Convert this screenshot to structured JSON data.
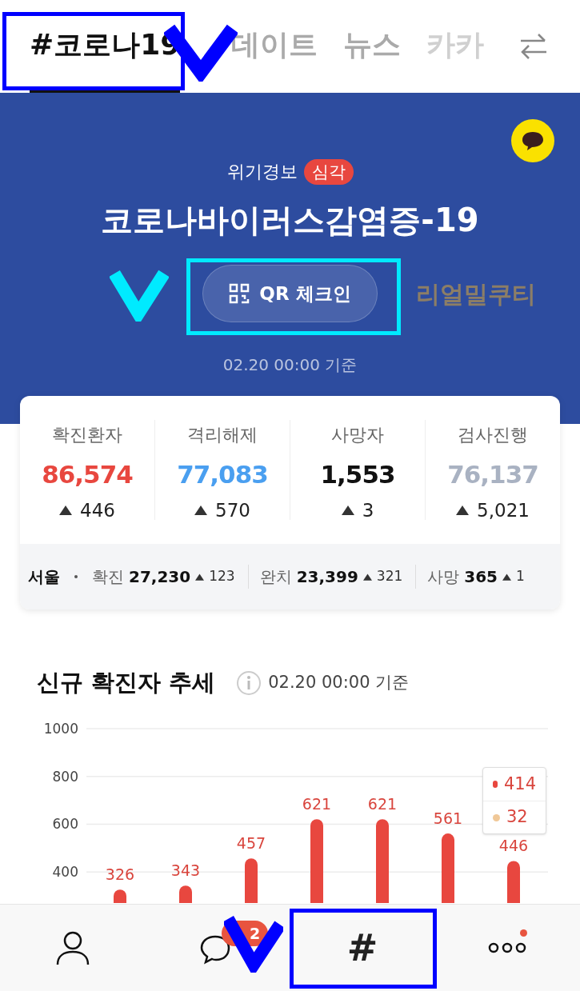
{
  "tabs": [
    {
      "label": "#코로나19",
      "selected": true
    },
    {
      "label": "데이트",
      "selected": false
    },
    {
      "label": "뉴스",
      "selected": false
    },
    {
      "label": "카카",
      "selected": false
    }
  ],
  "banner": {
    "alert_label": "위기경보",
    "alert_level": "심각",
    "title": "코로나바이러스감염증-19",
    "qr_button": "QR 체크인",
    "side_text": "리얼밀쿠티",
    "updated": "02.20 00:00 기준"
  },
  "stats": [
    {
      "label": "확진환자",
      "value": "86,574",
      "delta": "446",
      "color": "#e8473f"
    },
    {
      "label": "격리해제",
      "value": "77,083",
      "delta": "570",
      "color": "#4a9ff0"
    },
    {
      "label": "사망자",
      "value": "1,553",
      "delta": "3",
      "color": "#111111"
    },
    {
      "label": "검사진행",
      "value": "76,137",
      "delta": "5,021",
      "color": "#a9b2c2"
    }
  ],
  "region": {
    "name": "서울",
    "items": [
      {
        "label": "확진",
        "value": "27,230",
        "delta": "123"
      },
      {
        "label": "완치",
        "value": "23,399",
        "delta": "321"
      },
      {
        "label": "사망",
        "value": "365",
        "delta": "1"
      }
    ]
  },
  "trend": {
    "title": "신규 확진자 추세",
    "updated": "02.20 00:00 기준",
    "chart_data": {
      "type": "bar",
      "values": [
        326,
        343,
        457,
        621,
        621,
        561,
        446
      ],
      "ylim": [
        270,
        1000
      ],
      "grid": true,
      "yticks": [
        400,
        600,
        800,
        1000
      ],
      "data_labels": true
    },
    "tooltip": [
      {
        "value": "414",
        "color": "#e8473f"
      },
      {
        "value": "32",
        "color": "#f0c898"
      }
    ]
  },
  "nav": [
    {
      "kind": "profile"
    },
    {
      "kind": "chat",
      "badge": "2"
    },
    {
      "kind": "hash",
      "label": "#"
    },
    {
      "kind": "more",
      "dot": true
    }
  ]
}
